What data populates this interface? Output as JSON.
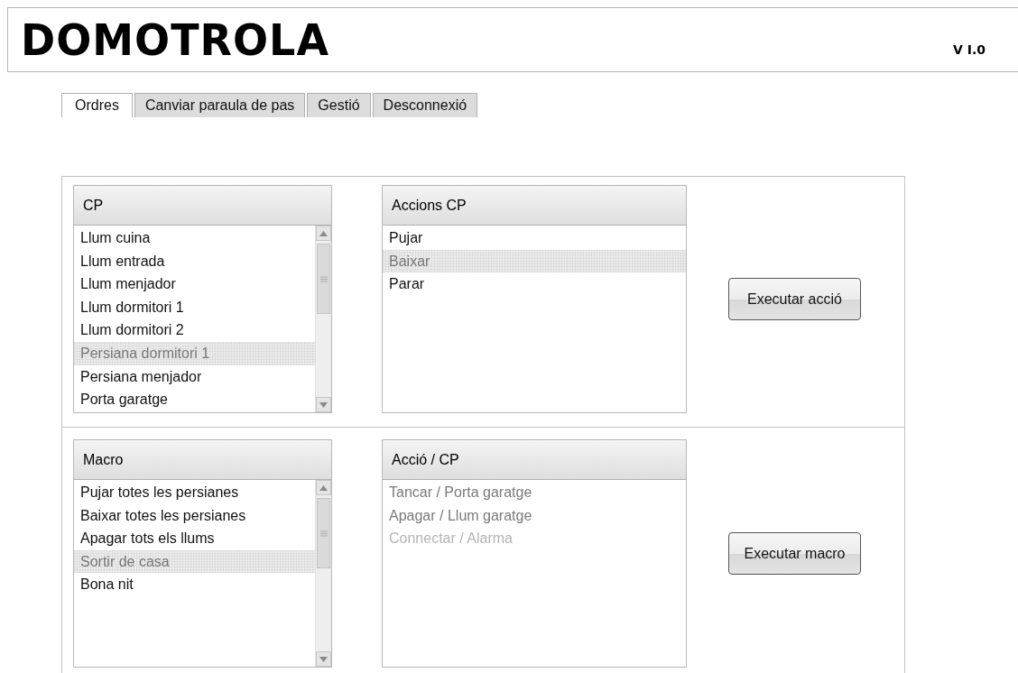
{
  "header": {
    "logo": "DOMOTROLA",
    "version": "V I.0"
  },
  "tabs": [
    {
      "label": "Ordres",
      "selected": true
    },
    {
      "label": "Canviar paraula de pas",
      "selected": false
    },
    {
      "label": "Gestió",
      "selected": false
    },
    {
      "label": "Desconnexió",
      "selected": false
    }
  ],
  "sections": [
    {
      "list": {
        "title": "CP",
        "scrollbar": true,
        "items": [
          {
            "label": "Llum cuina",
            "selected": false
          },
          {
            "label": "Llum entrada",
            "selected": false
          },
          {
            "label": "Llum menjador",
            "selected": false
          },
          {
            "label": "Llum dormitori 1",
            "selected": false
          },
          {
            "label": "Llum dormitori 2",
            "selected": false
          },
          {
            "label": "Persiana dormitori 1",
            "selected": true
          },
          {
            "label": "Persiana menjador",
            "selected": false
          },
          {
            "label": "Porta garatge",
            "selected": false
          }
        ]
      },
      "detail": {
        "title": "Accions CP",
        "items": [
          {
            "label": "Pujar",
            "selected": false
          },
          {
            "label": "Baixar",
            "selected": true
          },
          {
            "label": "Parar",
            "selected": false
          }
        ]
      },
      "button": "Executar acció"
    },
    {
      "list": {
        "title": "Macro",
        "scrollbar": true,
        "items": [
          {
            "label": "Pujar totes les persianes",
            "selected": false
          },
          {
            "label": "Baixar totes les persianes",
            "selected": false
          },
          {
            "label": "Apagar tots els llums",
            "selected": false
          },
          {
            "label": "Sortir de casa",
            "selected": true
          },
          {
            "label": "Bona nit",
            "selected": false
          }
        ]
      },
      "detail": {
        "title": "Acció / CP",
        "items": [
          {
            "label": "Tancar /  Porta garatge",
            "disabled": false
          },
          {
            "label": "Apagar / Llum garatge",
            "disabled": false
          },
          {
            "label": "Connectar / Alarma",
            "disabled": true
          }
        ]
      },
      "button": "Executar macro"
    }
  ]
}
